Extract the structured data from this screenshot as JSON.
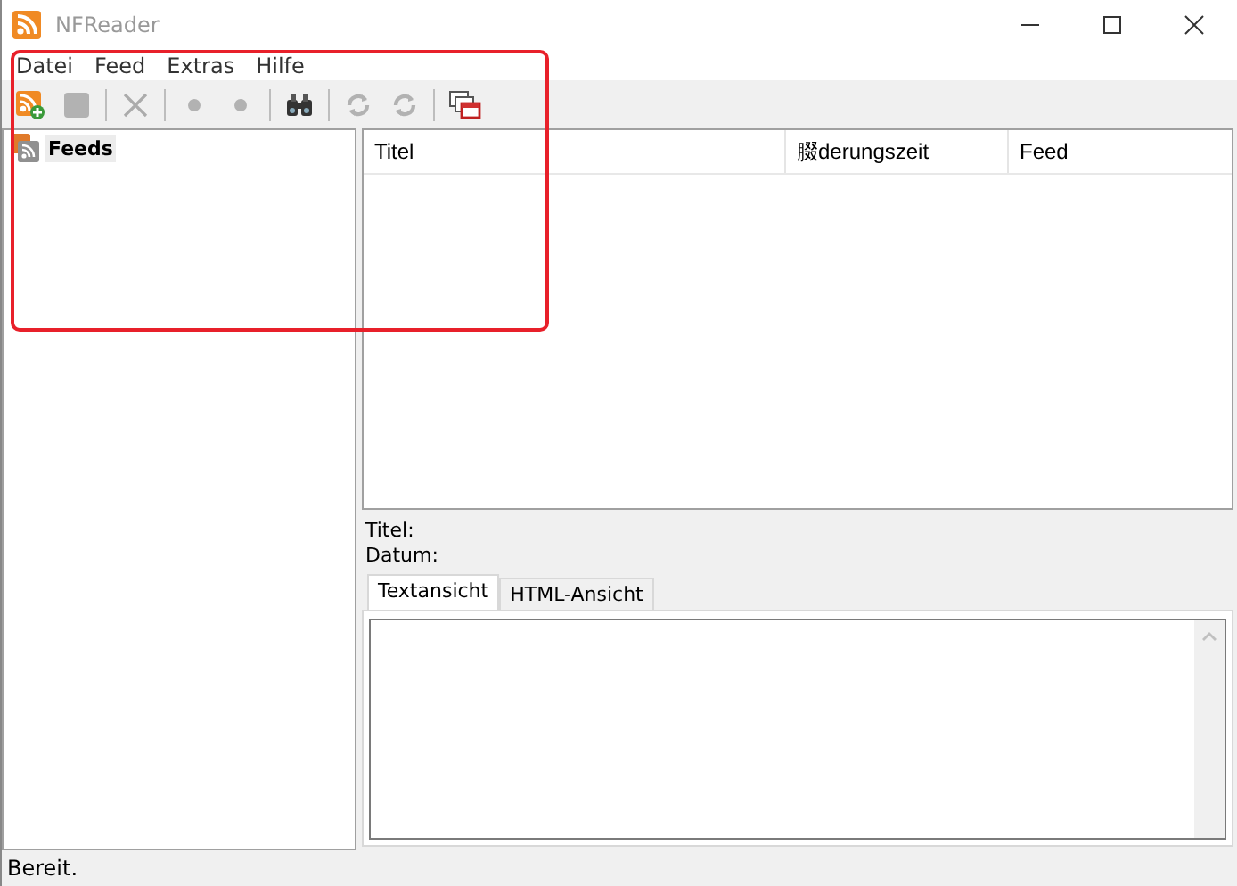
{
  "window": {
    "title": "NFReader"
  },
  "menu": [
    "Datei",
    "Feed",
    "Extras",
    "Hilfe"
  ],
  "toolbar": [
    {
      "kind": "feed-add",
      "disabled": false
    },
    {
      "kind": "stop",
      "disabled": true
    },
    {
      "kind": "separator"
    },
    {
      "kind": "delete",
      "disabled": true
    },
    {
      "kind": "separator"
    },
    {
      "kind": "previous",
      "disabled": true
    },
    {
      "kind": "next",
      "disabled": true
    },
    {
      "kind": "separator"
    },
    {
      "kind": "search",
      "disabled": false
    },
    {
      "kind": "separator"
    },
    {
      "kind": "refresh",
      "disabled": true
    },
    {
      "kind": "refresh-all",
      "disabled": true
    },
    {
      "kind": "separator"
    },
    {
      "kind": "windows",
      "disabled": false
    }
  ],
  "tree": [
    {
      "label": "Feeds",
      "selected": true
    }
  ],
  "table": {
    "columns": [
      "Titel",
      "腏derungszeit",
      "Feed"
    ]
  },
  "details": {
    "title_label": "Titel:",
    "date_label": "Datum:"
  },
  "tabs": [
    {
      "label": "Textansicht",
      "selected": true
    },
    {
      "label": "HTML-Ansicht",
      "selected": false
    }
  ],
  "status_bar": "Bereit."
}
